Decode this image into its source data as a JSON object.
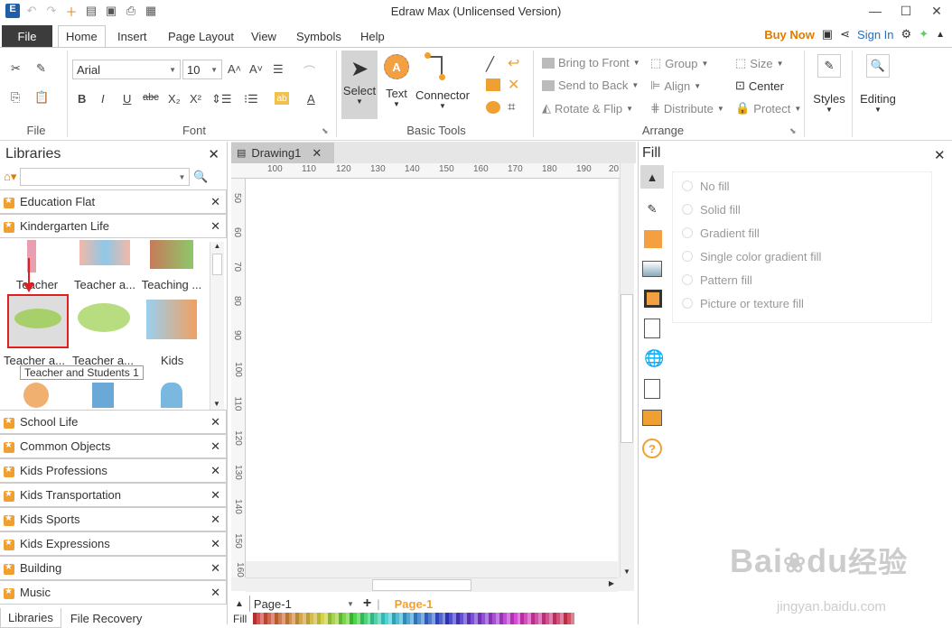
{
  "window": {
    "title": "Edraw Max (Unlicensed Version)"
  },
  "tabs": {
    "file": "File",
    "items": [
      "Home",
      "Insert",
      "Page Layout",
      "View",
      "Symbols",
      "Help"
    ],
    "active": "Home"
  },
  "header_right": {
    "buy_now": "Buy Now",
    "sign_in": "Sign In"
  },
  "ribbon": {
    "file_group": "File",
    "font": {
      "label": "Font",
      "family": "Arial",
      "size": "10"
    },
    "basic_tools": {
      "label": "Basic Tools",
      "select": "Select",
      "text": "Text",
      "connector": "Connector"
    },
    "arrange": {
      "label": "Arrange",
      "bring_to_front": "Bring to Front",
      "send_to_back": "Send to Back",
      "rotate_flip": "Rotate & Flip",
      "group": "Group",
      "align": "Align",
      "distribute": "Distribute",
      "size": "Size",
      "center": "Center",
      "protect": "Protect"
    },
    "styles": "Styles",
    "editing": "Editing"
  },
  "libraries": {
    "title": "Libraries",
    "sections": [
      "Education Flat",
      "Kindergarten Life"
    ],
    "shapes_row1": [
      "Teacher",
      "Teacher a...",
      "Teaching ..."
    ],
    "shapes_row2": [
      "Teacher a...",
      "Teacher a...",
      "Kids"
    ],
    "tooltip": "Teacher and Students 1",
    "bottom_sections": [
      "School Life",
      "Common Objects",
      "Kids Professions",
      "Kids Transportation",
      "Kids Sports",
      "Kids Expressions",
      "Building",
      "Music"
    ],
    "bottom_tabs": [
      "Libraries",
      "File Recovery"
    ]
  },
  "document": {
    "tab": "Drawing1",
    "page_select": "Page-1",
    "page_tab": "Page-1"
  },
  "ruler": {
    "h": [
      "100",
      "110",
      "120",
      "130",
      "140",
      "150",
      "160",
      "170",
      "180",
      "190",
      "20"
    ],
    "v": [
      "50",
      "60",
      "70",
      "80",
      "90",
      "100",
      "110",
      "120",
      "130",
      "140",
      "150",
      "160"
    ]
  },
  "fill_panel": {
    "title": "Fill",
    "options": [
      "No fill",
      "Solid fill",
      "Gradient fill",
      "Single color gradient fill",
      "Pattern fill",
      "Picture or texture fill"
    ]
  },
  "status": {
    "fill_label": "Fill"
  },
  "watermark": {
    "line1": "Bai",
    "line2": "du",
    "line3": "经验",
    "url": "jingyan.baidu.com"
  },
  "colors": {
    "accent": "#f0a030",
    "buy": "#e07b00",
    "link": "#2a6ebb",
    "filebar": "#3c3c3c"
  }
}
